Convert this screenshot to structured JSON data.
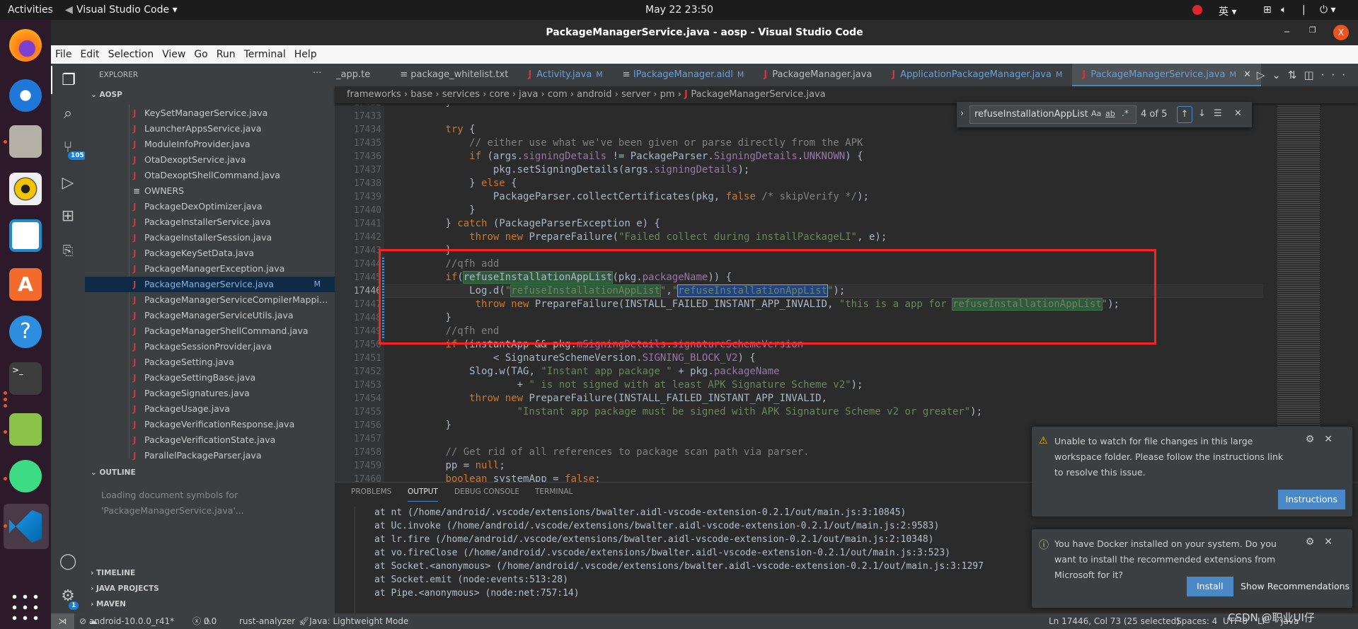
{
  "system": {
    "activities": "Activities",
    "app_menu": "Visual Studio Code ▾",
    "clock": "May 22  23:50",
    "ime": "英 ▾"
  },
  "window": {
    "title": "PackageManagerService.java - aosp - Visual Studio Code"
  },
  "menu": [
    "File",
    "Edit",
    "Selection",
    "View",
    "Go",
    "Run",
    "Terminal",
    "Help"
  ],
  "activity_bar": {
    "scm_badge": "105",
    "settings_badge": "1"
  },
  "sidebar": {
    "header": "EXPLORER",
    "more": "···",
    "root": "AOSP",
    "files": [
      {
        "name": "KeySetManagerService.java",
        "type": "java"
      },
      {
        "name": "LauncherAppsService.java",
        "type": "java"
      },
      {
        "name": "ModuleInfoProvider.java",
        "type": "java"
      },
      {
        "name": "OtaDexoptService.java",
        "type": "java"
      },
      {
        "name": "OtaDexoptShellCommand.java",
        "type": "java"
      },
      {
        "name": "OWNERS",
        "type": "text"
      },
      {
        "name": "PackageDexOptimizer.java",
        "type": "java"
      },
      {
        "name": "PackageInstallerService.java",
        "type": "java"
      },
      {
        "name": "PackageInstallerSession.java",
        "type": "java"
      },
      {
        "name": "PackageKeySetData.java",
        "type": "java"
      },
      {
        "name": "PackageManagerException.java",
        "type": "java"
      },
      {
        "name": "PackageManagerService.java",
        "type": "java",
        "selected": true,
        "status": "M"
      },
      {
        "name": "PackageManagerServiceCompilerMapping.java",
        "type": "java"
      },
      {
        "name": "PackageManagerServiceUtils.java",
        "type": "java"
      },
      {
        "name": "PackageManagerShellCommand.java",
        "type": "java"
      },
      {
        "name": "PackageSessionProvider.java",
        "type": "java"
      },
      {
        "name": "PackageSetting.java",
        "type": "java"
      },
      {
        "name": "PackageSettingBase.java",
        "type": "java"
      },
      {
        "name": "PackageSignatures.java",
        "type": "java"
      },
      {
        "name": "PackageUsage.java",
        "type": "java"
      },
      {
        "name": "PackageVerificationResponse.java",
        "type": "java"
      },
      {
        "name": "PackageVerificationState.java",
        "type": "java"
      },
      {
        "name": "ParallelPackageParser.java",
        "type": "java"
      }
    ],
    "outline": {
      "title": "OUTLINE",
      "message": "Loading document symbols for 'PackageManagerService.java'..."
    },
    "timeline": "TIMELINE",
    "java_projects": "JAVA PROJECTS",
    "maven": "MAVEN"
  },
  "tabs": [
    {
      "label": "_app.te",
      "icon": "none"
    },
    {
      "label": "package_whitelist.txt",
      "icon": "text"
    },
    {
      "label": "Activity.java",
      "icon": "java",
      "status": "M"
    },
    {
      "label": "IPackageManager.aidl",
      "icon": "text",
      "status": "M"
    },
    {
      "label": "PackageManager.java",
      "icon": "java"
    },
    {
      "label": "ApplicationPackageManager.java",
      "icon": "java",
      "status": "M"
    },
    {
      "label": "PackageManagerService.java",
      "icon": "java",
      "status": "M",
      "active": true
    }
  ],
  "breadcrumb": [
    "frameworks",
    "base",
    "services",
    "core",
    "java",
    "com",
    "android",
    "server",
    "pm",
    "PackageManagerService.java"
  ],
  "find": {
    "query": "refuseInstallationAppList",
    "case": "Aa",
    "word": "ab",
    "regex": ".*",
    "count": "4 of 5"
  },
  "editor": {
    "current_line": 17446,
    "match_word": "refuseInstallationAppList",
    "lines": [
      {
        "n": 17432,
        "t": "        }"
      },
      {
        "n": 17433,
        "t": ""
      },
      {
        "n": 17434,
        "t": "        try {"
      },
      {
        "n": 17435,
        "t": "            // either use what we've been given or parse directly from the APK"
      },
      {
        "n": 17436,
        "t": "            if (args.signingDetails != PackageParser.SigningDetails.UNKNOWN) {"
      },
      {
        "n": 17437,
        "t": "                pkg.setSigningDetails(args.signingDetails);"
      },
      {
        "n": 17438,
        "t": "            } else {"
      },
      {
        "n": 17439,
        "t": "                PackageParser.collectCertificates(pkg, false /* skipVerify */);"
      },
      {
        "n": 17440,
        "t": "            }"
      },
      {
        "n": 17441,
        "t": "        } catch (PackageParserException e) {"
      },
      {
        "n": 17442,
        "t": "            throw new PrepareFailure(\"Failed collect during installPackageLI\", e);"
      },
      {
        "n": 17443,
        "t": "        }"
      },
      {
        "n": 17444,
        "t": "        //qfh add"
      },
      {
        "n": 17445,
        "t": "        if(refuseInstallationAppList(pkg.packageName)) {"
      },
      {
        "n": 17446,
        "t": "            Log.d(\"refuseInstallationAppList\",\"refuseInstallationAppList\");"
      },
      {
        "n": 17447,
        "t": "             throw new PrepareFailure(INSTALL_FAILED_INSTANT_APP_INVALID, \"this is a app for refuseInstallationAppList\");"
      },
      {
        "n": 17448,
        "t": "        }"
      },
      {
        "n": 17449,
        "t": "        //qfh end"
      },
      {
        "n": 17450,
        "t": "        if (instantApp && pkg.mSigningDetails.signatureSchemeVersion"
      },
      {
        "n": 17451,
        "t": "                < SignatureSchemeVersion.SIGNING_BLOCK_V2) {"
      },
      {
        "n": 17452,
        "t": "            Slog.w(TAG, \"Instant app package \" + pkg.packageName"
      },
      {
        "n": 17453,
        "t": "                    + \" is not signed with at least APK Signature Scheme v2\");"
      },
      {
        "n": 17454,
        "t": "            throw new PrepareFailure(INSTALL_FAILED_INSTANT_APP_INVALID,"
      },
      {
        "n": 17455,
        "t": "                    \"Instant app package must be signed with APK Signature Scheme v2 or greater\");"
      },
      {
        "n": 17456,
        "t": "        }"
      },
      {
        "n": 17457,
        "t": ""
      },
      {
        "n": 17458,
        "t": "        // Get rid of all references to package scan path via parser."
      },
      {
        "n": 17459,
        "t": "        pp = null;"
      },
      {
        "n": 17460,
        "t": "        boolean systemApp = false;"
      }
    ]
  },
  "panel": {
    "tabs": [
      "PROBLEMS",
      "OUTPUT",
      "DEBUG CONSOLE",
      "TERMINAL"
    ],
    "active_tab": "OUTPUT",
    "output": [
      "at nt (/home/android/.vscode/extensions/bwalter.aidl-vscode-extension-0.2.1/out/main.js:3:10845)",
      "at Uc.invoke (/home/android/.vscode/extensions/bwalter.aidl-vscode-extension-0.2.1/out/main.js:2:9583)",
      "at lr.fire (/home/android/.vscode/extensions/bwalter.aidl-vscode-extension-0.2.1/out/main.js:2:10348)",
      "at vo.fireClose (/home/android/.vscode/extensions/bwalter.aidl-vscode-extension-0.2.1/out/main.js:3:523)",
      "at Socket.<anonymous> (/home/android/.vscode/extensions/bwalter.aidl-vscode-extension-0.2.1/out/main.js:3:1297",
      "at Socket.emit (node:events:513:28)",
      "at Pipe.<anonymous> (node:net:757:14)"
    ]
  },
  "notifications": [
    {
      "icon": "warning-icon",
      "message": "Unable to watch for file changes in this large workspace folder. Please follow the instructions link to resolve this issue.",
      "primary": "Instructions"
    },
    {
      "icon": "info-icon",
      "message": "You have Docker installed on your system. Do you want to install the recommended extensions from Microsoft for it?",
      "primary": "Install",
      "secondary": "Show Recommendations"
    }
  ],
  "status": {
    "branch": "android-10.0.0_r41*",
    "errors": "0",
    "warnings": "0",
    "rust": "rust-analyzer",
    "java": "Java: Lightweight Mode",
    "position": "Ln 17446, Col 73 (25 selected)",
    "spaces": "Spaces: 4",
    "encoding": "UTF-8",
    "eol": "LF",
    "language": "Java"
  },
  "watermark": "CSDN @职业UI仔",
  "colors": {
    "accent": "#4a88c7",
    "keyword": "#cc7832",
    "string": "#6a8759",
    "comment": "#808080",
    "field": "#9876aa",
    "annotation_box": "#ff2121"
  }
}
